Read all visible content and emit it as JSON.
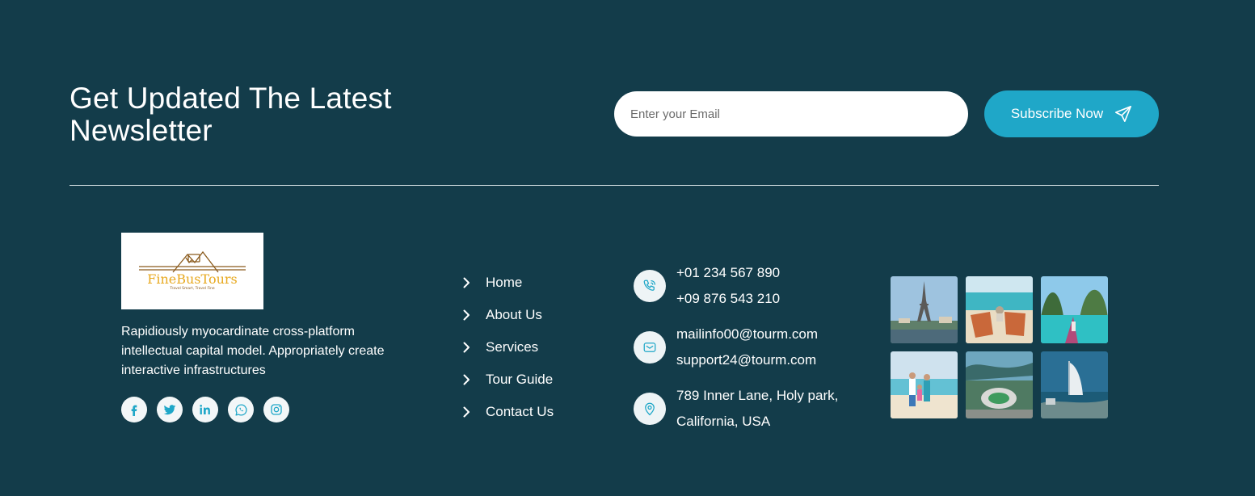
{
  "newsletter": {
    "title": "Get Updated The Latest Newsletter",
    "email_placeholder": "Enter your Email",
    "subscribe_label": "Subscribe Now",
    "button_color": "#1fa7c8"
  },
  "colors": {
    "background": "#133c4a",
    "accent": "#1fa7c8",
    "logo_gold": "#e8a91f"
  },
  "footer": {
    "logo": {
      "brand": "FineBusTours",
      "tagline": "Travel Smart, Travel Fine"
    },
    "about": "Rapidiously myocardinate cross-platform intellectual capital model. Appropriately create interactive infrastructures",
    "socials": [
      {
        "icon": "facebook-icon"
      },
      {
        "icon": "twitter-icon"
      },
      {
        "icon": "linkedin-icon"
      },
      {
        "icon": "whatsapp-icon"
      },
      {
        "icon": "instagram-icon"
      }
    ],
    "links": [
      {
        "label": "Home"
      },
      {
        "label": "About Us"
      },
      {
        "label": "Services"
      },
      {
        "label": "Tour Guide"
      },
      {
        "label": "Contact Us"
      }
    ],
    "contact": {
      "phones": [
        "+01 234 567 890",
        "+09 876 543 210"
      ],
      "emails": [
        "mailinfo00@tourm.com",
        "support24@tourm.com"
      ],
      "address": [
        "789 Inner Lane, Holy park,",
        "California, USA"
      ]
    },
    "gallery": [
      {
        "subject": "eiffel-tower"
      },
      {
        "subject": "beach-loungers"
      },
      {
        "subject": "longtail-boat-islands"
      },
      {
        "subject": "family-on-beach"
      },
      {
        "subject": "aerial-stadium-coast"
      },
      {
        "subject": "burj-al-arab"
      }
    ]
  }
}
